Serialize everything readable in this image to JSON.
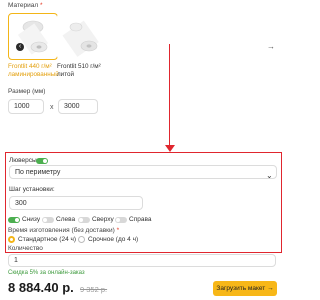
{
  "material": {
    "label": "Материал",
    "required_mark": "*",
    "cards": [
      {
        "title": "Frontlit 440 г/м² ламинированный"
      },
      {
        "title": "Frontlit 510 г/м² литой"
      }
    ],
    "prev_icon": "‹",
    "next_icon": "→"
  },
  "size": {
    "label": "Размер (мм)",
    "width": "1000",
    "separator": "x",
    "height": "3000"
  },
  "grommets": {
    "label": "Люверсы",
    "enabled": true,
    "placement_selected": "По периметру",
    "step_label": "Шаг установки:",
    "step_value": "300",
    "sides": [
      {
        "label": "Снизу",
        "on": true
      },
      {
        "label": "Слева",
        "on": false
      },
      {
        "label": "Сверху",
        "on": false
      },
      {
        "label": "Справа",
        "on": false
      }
    ]
  },
  "production": {
    "label": "Время изготовления (без доставки)",
    "required_mark": "*",
    "options": [
      {
        "label": "Стандартное (24 ч)",
        "checked": true
      },
      {
        "label": "Срочное (до 4 ч)",
        "checked": false
      }
    ]
  },
  "quantity": {
    "label": "Количество",
    "value": "1"
  },
  "discount_note": "Скидка 5% за онлайн-заказ",
  "price": {
    "current": "8 884.40 р.",
    "old": "9 352 р."
  },
  "upload_button": {
    "label": "Загрузить макет →"
  },
  "colors": {
    "accent": "#f3b517",
    "annotation_red": "#e0262e",
    "toggle_on": "#4caf50",
    "discount_green": "#3c9a3c"
  }
}
